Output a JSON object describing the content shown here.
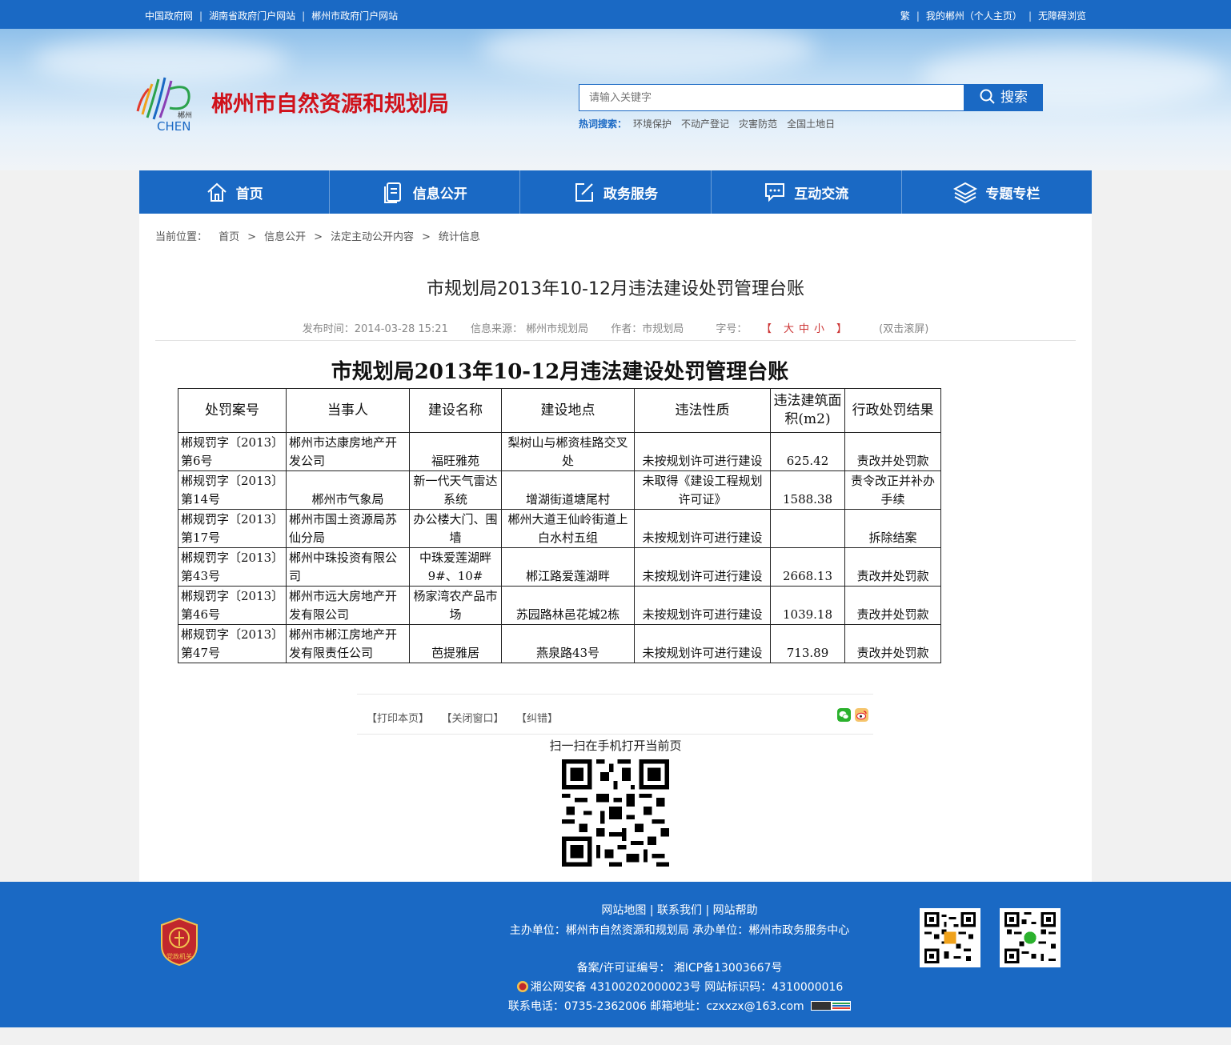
{
  "topbar": {
    "left_links": [
      "中国政府网",
      "湖南省政府门户网站",
      "郴州市政府门户网站"
    ],
    "right_links": [
      "繁",
      "我的郴州（个人主页）",
      "无障碍浏览"
    ]
  },
  "header": {
    "site_title": "郴州市自然资源和规划局",
    "logo_small_text": "郴州",
    "logo_text": "CHEN",
    "search": {
      "placeholder": "请输入关键字",
      "button_label": "搜索"
    },
    "hotwords_label": "热词搜索：",
    "hotwords": [
      "环境保护",
      "不动产登记",
      "灾害防范",
      "全国土地日"
    ]
  },
  "nav": [
    "首页",
    "信息公开",
    "政务服务",
    "互动交流",
    "专题专栏"
  ],
  "breadcrumb": {
    "label": "当前位置：",
    "items": [
      "首页",
      "信息公开",
      "法定主动公开内容",
      "统计信息"
    ]
  },
  "article": {
    "title": "市规划局2013年10-12月违法建设处罚管理台账",
    "published": "发布时间：2014-03-28 15:21",
    "source": "信息来源：  郴州市规划局",
    "author": "作者：市规划局",
    "font_size_label": "字号：",
    "font_sizes": [
      "大",
      "中",
      "小"
    ],
    "font_open": "【",
    "font_close": "】",
    "dblclick": "(双击滚屏)",
    "doc_title": "市规划局2013年10-12月违法建设处罚管理台账"
  },
  "table": {
    "headers": [
      "处罚案号",
      "当事人",
      "建设名称",
      "建设地点",
      "违法性质",
      "违法建筑面积(m2)",
      "行政处罚结果"
    ],
    "rows": [
      [
        "郴规罚字〔2013〕第6号",
        "郴州市达康房地产开发公司",
        "福旺雅苑",
        "梨树山与郴资桂路交叉处",
        "未按规划许可进行建设",
        "625.42",
        "责改并处罚款"
      ],
      [
        "郴规罚字〔2013〕第14号",
        "郴州市气象局",
        "新一代天气雷达系统",
        "增湖街道塘尾村",
        "未取得《建设工程规划许可证》",
        "1588.38",
        "责令改正并补办手续"
      ],
      [
        "郴规罚字〔2013〕第17号",
        "郴州市国土资源局苏仙分局",
        "办公楼大门、围墙",
        "郴州大道王仙岭街道上白水村五组",
        "未按规划许可进行建设",
        "",
        "拆除结案"
      ],
      [
        "郴规罚字〔2013〕第43号",
        "郴州中珠投资有限公司",
        "中珠爱莲湖畔9#、10#",
        "郴江路爱莲湖畔",
        "未按规划许可进行建设",
        "2668.13",
        "责改并处罚款"
      ],
      [
        "郴规罚字〔2013〕第46号",
        "郴州市远大房地产开发有限公司",
        "杨家湾农产品市场",
        "苏园路林邑花城2栋",
        "未按规划许可进行建设",
        "1039.18",
        "责改并处罚款"
      ],
      [
        "郴规罚字〔2013〕第47号",
        "郴州市郴江房地产开发有限责任公司",
        "芭提雅居",
        "燕泉路43号",
        "未按规划许可进行建设",
        "713.89",
        "责改并处罚款"
      ]
    ]
  },
  "tools": {
    "print": "【打印本页】",
    "close": "【关闭窗口】",
    "error": "【纠错】",
    "scan_text": "扫一扫在手机打开当前页"
  },
  "footer": {
    "links": [
      "网站地图",
      "联系我们",
      "网站帮助"
    ],
    "sponsor": "主办单位：郴州市自然资源和规划局    承办单位：郴州市政务服务中心",
    "icp": "备案/许可证编号： 湘ICP备13003667号",
    "police": "湘公网安备 43100202000023号    网站标识码：4310000016",
    "contact": "联系电话：0735-2362006    邮箱地址：czxxzx@163.com",
    "emblem_text": "党政机关"
  },
  "colors": {
    "brand": "#1a69c4",
    "title_red": "#d0121b"
  }
}
